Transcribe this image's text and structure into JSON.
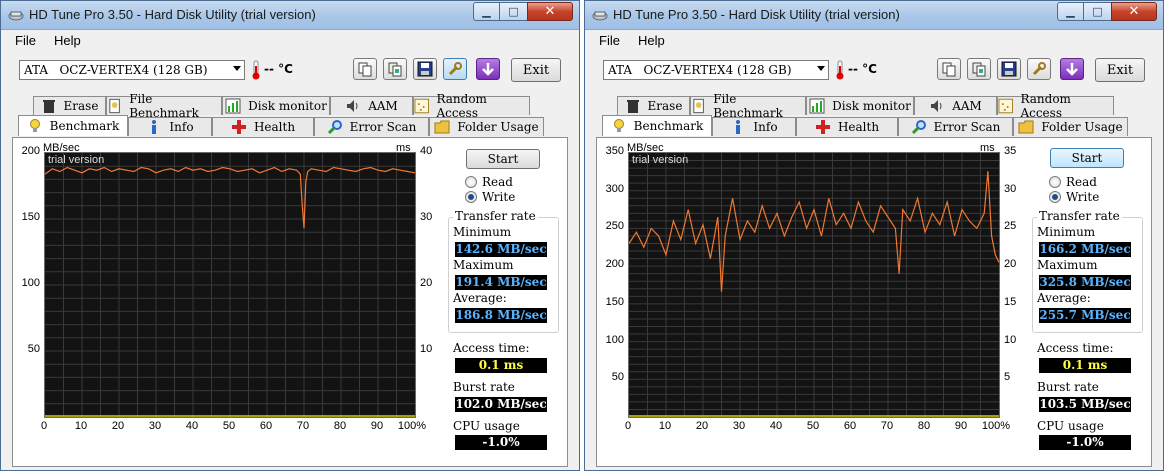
{
  "windows": [
    {
      "title": "HD Tune Pro 3.50 - Hard Disk Utility (trial version)",
      "menu": {
        "file": "File",
        "help": "Help"
      },
      "drive": "ATA   OCZ-VERTEX4 (128 GB)",
      "temperature": "-- °C",
      "exit_label": "Exit",
      "tabs_top": [
        "Erase",
        "File Benchmark",
        "Disk monitor",
        "AAM",
        "Random Access"
      ],
      "tabs_bottom": [
        "Benchmark",
        "Info",
        "Health",
        "Error Scan",
        "Folder Usage"
      ],
      "selected_tab": "Benchmark",
      "start_label": "Start",
      "radio": {
        "read": "Read",
        "write": "Write",
        "selected": "Write"
      },
      "transfer_rate": {
        "title": "Transfer rate",
        "min_label": "Minimum",
        "min": "142.6 MB/sec",
        "max_label": "Maximum",
        "max": "191.4 MB/sec",
        "avg_label": "Average:",
        "avg": "186.8 MB/sec"
      },
      "access_time": {
        "label": "Access time:",
        "value": "0.1 ms"
      },
      "burst_rate": {
        "label": "Burst rate",
        "value": "102.0 MB/sec"
      },
      "cpu_usage": {
        "label": "CPU usage",
        "value": "-1.0%"
      },
      "chart": {
        "trial_text": "trial version",
        "left_unit": "MB/sec",
        "right_unit": "ms",
        "left_ticks": [
          "200",
          "150",
          "100",
          "50"
        ],
        "right_ticks": [
          "40",
          "30",
          "20",
          "10"
        ],
        "x_ticks": [
          "0",
          "10",
          "20",
          "30",
          "40",
          "50",
          "60",
          "70",
          "80",
          "90",
          "100%"
        ]
      },
      "chart_data": {
        "type": "line",
        "title": "",
        "xlabel": "",
        "ylabel": "MB/sec",
        "xlim": [
          0,
          100
        ],
        "ylim": [
          0,
          200
        ],
        "y2lim": [
          0,
          40
        ],
        "series": [
          {
            "x": [
              0,
              2,
              4,
              6,
              8,
              10,
              12,
              14,
              16,
              18,
              20,
              22,
              24,
              26,
              28,
              30,
              32,
              34,
              36,
              38,
              40,
              42,
              44,
              46,
              48,
              50,
              52,
              54,
              56,
              58,
              60,
              62,
              64,
              66,
              68,
              69,
              69.5,
              70,
              70.5,
              71,
              72,
              74,
              76,
              78,
              80,
              82,
              84,
              86,
              88,
              90,
              92,
              94,
              96,
              98,
              100
            ],
            "values": [
              184,
              188,
              186,
              189,
              187,
              185,
              188,
              187,
              189,
              186,
              188,
              187,
              186,
              189,
              188,
              185,
              187,
              188,
              186,
              189,
              187,
              188,
              186,
              187,
              189,
              188,
              186,
              187,
              188,
              185,
              187,
              189,
              186,
              188,
              187,
              184,
              162,
              143,
              178,
              186,
              188,
              187,
              186,
              189,
              188,
              187,
              186,
              188,
              189,
              187,
              186,
              188,
              187,
              186,
              185
            ]
          }
        ]
      }
    },
    {
      "title": "HD Tune Pro 3.50 - Hard Disk Utility (trial version)",
      "menu": {
        "file": "File",
        "help": "Help"
      },
      "drive": "ATA   OCZ-VERTEX4 (128 GB)",
      "temperature": "-- °C",
      "exit_label": "Exit",
      "tabs_top": [
        "Erase",
        "File Benchmark",
        "Disk monitor",
        "AAM",
        "Random Access"
      ],
      "tabs_bottom": [
        "Benchmark",
        "Info",
        "Health",
        "Error Scan",
        "Folder Usage"
      ],
      "selected_tab": "Benchmark",
      "start_label": "Start",
      "radio": {
        "read": "Read",
        "write": "Write",
        "selected": "Write"
      },
      "transfer_rate": {
        "title": "Transfer rate",
        "min_label": "Minimum",
        "min": "166.2 MB/sec",
        "max_label": "Maximum",
        "max": "325.8 MB/sec",
        "avg_label": "Average:",
        "avg": "255.7 MB/sec"
      },
      "access_time": {
        "label": "Access time:",
        "value": "0.1 ms"
      },
      "burst_rate": {
        "label": "Burst rate",
        "value": "103.5 MB/sec"
      },
      "cpu_usage": {
        "label": "CPU usage",
        "value": "-1.0%"
      },
      "chart": {
        "trial_text": "trial version",
        "left_unit": "MB/sec",
        "right_unit": "ms",
        "left_ticks": [
          "350",
          "300",
          "250",
          "200",
          "150",
          "100",
          "50"
        ],
        "right_ticks": [
          "35",
          "30",
          "25",
          "20",
          "15",
          "10",
          "5"
        ],
        "x_ticks": [
          "0",
          "10",
          "20",
          "30",
          "40",
          "50",
          "60",
          "70",
          "80",
          "90",
          "100%"
        ]
      },
      "chart_data": {
        "type": "line",
        "title": "",
        "xlabel": "",
        "ylabel": "MB/sec",
        "xlim": [
          0,
          100
        ],
        "ylim": [
          0,
          350
        ],
        "y2lim": [
          0,
          35
        ],
        "series": [
          {
            "x": [
              0,
              2,
              4,
              6,
              8,
              10,
              12,
              14,
              16,
              18,
              20,
              22,
              24,
              25,
              26,
              28,
              30,
              32,
              34,
              36,
              38,
              40,
              42,
              44,
              46,
              48,
              50,
              52,
              54,
              56,
              58,
              60,
              62,
              64,
              66,
              68,
              70,
              72,
              73,
              74,
              76,
              78,
              80,
              82,
              84,
              86,
              88,
              90,
              92,
              94,
              96,
              97,
              98,
              99,
              100
            ],
            "values": [
              230,
              245,
              225,
              250,
              240,
              215,
              260,
              235,
              275,
              230,
              255,
              210,
              265,
              166,
              240,
              290,
              235,
              260,
              245,
              280,
              250,
              270,
              240,
              265,
              285,
              250,
              275,
              240,
              290,
              255,
              270,
              250,
              285,
              260,
              245,
              280,
              265,
              250,
              190,
              275,
              260,
              290,
              245,
              270,
              255,
              285,
              240,
              275,
              260,
              250,
              270,
              326,
              240,
              215,
              205
            ]
          }
        ]
      }
    }
  ]
}
